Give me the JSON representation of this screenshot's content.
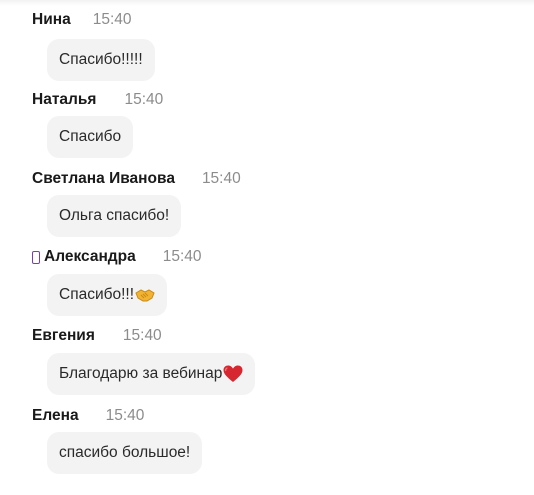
{
  "messages": [
    {
      "author": "Нина",
      "time": "15:40",
      "text": "Спасибо!!!!!"
    },
    {
      "author": "Наталья",
      "time": "15:40",
      "text": "Спасибо"
    },
    {
      "author": "Светлана Иванова",
      "time": "15:40",
      "text": "Ольга спасибо!"
    },
    {
      "author": "Александра",
      "time": "15:40",
      "text": "Спасибо!!!",
      "author_icon": "mobile-phone-icon",
      "emoji": "handshake-icon"
    },
    {
      "author": "Евгения",
      "time": "15:40",
      "text": "Благодарю за вебинар",
      "emoji": "red-heart-icon"
    },
    {
      "author": "Елена",
      "time": "15:40",
      "text": "спасибо большое!"
    }
  ],
  "colors": {
    "bubble": "#f3f3f3",
    "author": "#1a1a1a",
    "time": "#8c8c8c",
    "phone_icon": "#7a3db8",
    "heart": "#d6262f",
    "handshake": "#f2b233"
  }
}
